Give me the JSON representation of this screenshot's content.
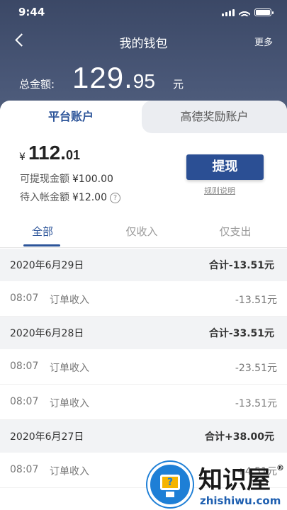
{
  "status": {
    "time": "9:44"
  },
  "nav": {
    "title": "我的钱包",
    "more": "更多"
  },
  "total": {
    "label": "总金额:",
    "int": "129.",
    "dec": "95",
    "unit": "元"
  },
  "accounts": {
    "tabs": [
      "平台账户",
      "高德奖励账户"
    ]
  },
  "balance": {
    "currency": "¥",
    "int": "112.",
    "dec": "01",
    "withdrawable_label": "可提现金额",
    "withdrawable_value": "¥100.00",
    "pending_label": "待入帐金额",
    "pending_value": "¥12.00",
    "withdraw_button": "提现",
    "rules_link": "规则说明"
  },
  "filters": [
    "全部",
    "仅收入",
    "仅支出"
  ],
  "days": [
    {
      "date": "2020年6月29日",
      "sum": "合计-13.51元",
      "entries": [
        {
          "time": "08:07",
          "desc": "订单收入",
          "amount": "-13.51元"
        }
      ]
    },
    {
      "date": "2020年6月28日",
      "sum": "合计-33.51元",
      "entries": [
        {
          "time": "08:07",
          "desc": "订单收入",
          "amount": "-23.51元"
        },
        {
          "time": "08:07",
          "desc": "订单收入",
          "amount": "-13.51元"
        }
      ]
    },
    {
      "date": "2020年6月27日",
      "sum": "合计+38.00元",
      "entries": [
        {
          "time": "08:07",
          "desc": "订单收入",
          "amount": "+4.51元"
        }
      ]
    }
  ],
  "watermark": {
    "title": "知识屋",
    "reg": "®",
    "domain": "zhishiwu.com",
    "badge": "?"
  },
  "colors": {
    "header": "#3b4866",
    "accent": "#2c5499",
    "button": "#2b4f94"
  }
}
